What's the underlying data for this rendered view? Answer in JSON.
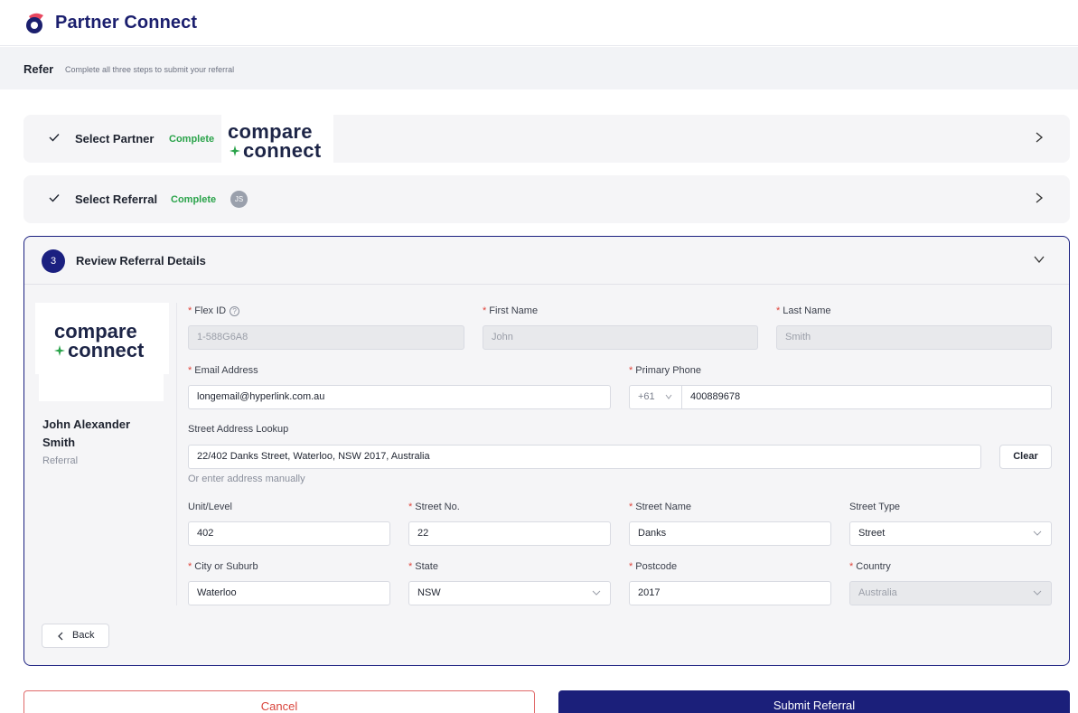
{
  "app": {
    "name": "Partner Connect"
  },
  "page": {
    "title": "Refer",
    "hint": "Complete all three steps to submit your referral"
  },
  "steps": [
    {
      "label": "Select Partner",
      "status": "Complete",
      "partner_logo": {
        "line1": "compare",
        "line2": "connect"
      }
    },
    {
      "label": "Select Referral",
      "status": "Complete",
      "avatar_initials": "JS"
    },
    {
      "number": "3",
      "label": "Review Referral Details"
    }
  ],
  "sidebar": {
    "logo": {
      "line1": "compare",
      "line2": "connect"
    },
    "name": "John Alexander Smith",
    "role": "Referral"
  },
  "form": {
    "flex_id": {
      "label": "Flex ID",
      "value": "1-588G6A8",
      "help": "?"
    },
    "first_name": {
      "label": "First Name",
      "value": "John"
    },
    "last_name": {
      "label": "Last Name",
      "value": "Smith"
    },
    "email": {
      "label": "Email Address",
      "value": "longemail@hyperlink.com.au"
    },
    "phone": {
      "label": "Primary Phone",
      "country_code": "+61",
      "value": "400889678"
    },
    "address_lookup": {
      "label": "Street Address Lookup",
      "value": "22/402 Danks Street, Waterloo, NSW 2017, Australia",
      "clear_label": "Clear"
    },
    "manual_link": "Or enter address manually",
    "unit": {
      "label": "Unit/Level",
      "value": "402"
    },
    "street_no": {
      "label": "Street No.",
      "value": "22"
    },
    "street_name": {
      "label": "Street Name",
      "value": "Danks"
    },
    "street_type": {
      "label": "Street Type",
      "value": "Street"
    },
    "city": {
      "label": "City or Suburb",
      "value": "Waterloo"
    },
    "state": {
      "label": "State",
      "value": "NSW"
    },
    "postcode": {
      "label": "Postcode",
      "value": "2017"
    },
    "country": {
      "label": "Country",
      "value": "Australia"
    },
    "required_mark": "*"
  },
  "actions": {
    "back": "Back",
    "cancel": "Cancel",
    "submit": "Submit Referral"
  },
  "colors": {
    "brand_navy": "#1b1f7a",
    "success_green": "#2aa34a",
    "danger_red": "#d9443b",
    "logo_green": "#2aa34a",
    "logo_pink": "#e8475f"
  }
}
